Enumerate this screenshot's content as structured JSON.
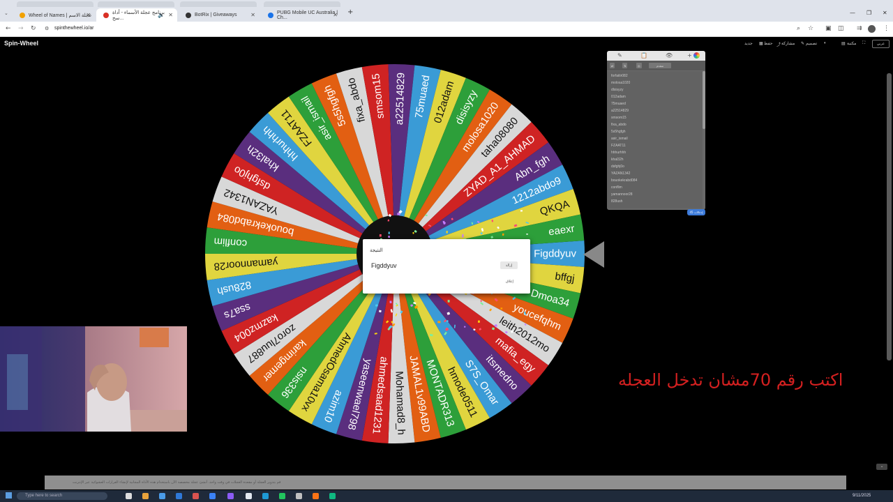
{
  "browser": {
    "tabs": [
      {
        "label": "Wheel of Names | عجلة الاسم",
        "color": "#f2a100"
      },
      {
        "label": "برنامج عجلة الأسماء - أداة سح...",
        "color": "#d93025"
      },
      {
        "label": "BotRix | Giveaways",
        "color": "#333333"
      },
      {
        "label": "PUBG Mobile UC Australia | Ch...",
        "color": "#1a73e8"
      }
    ],
    "url": "spinthewheel.io/ar"
  },
  "site": {
    "brand": "Spin-Wheel",
    "nav": {
      "new": "جديد",
      "save": "حفظ",
      "share": "مشاركة",
      "design": "تصميم",
      "library": "مكتبة",
      "language": "عربي"
    }
  },
  "wheel": {
    "entries": [
      "Figddyuv",
      "bffgj",
      "Dmoa34",
      "youcefqhm",
      "leith2012mo",
      "mafia_egy",
      "itsmedno",
      "S7S_Omar",
      "hmode0511",
      "MONTADR313",
      "JAMAL1v99ABD",
      "Mohamad8_h",
      "ahmedsaad1231",
      "yaseenwael798",
      "azim10",
      "AhmedOsama10vx",
      "nsis336",
      "karimgemer",
      "zoro7luu887",
      "kazmz004",
      "ssa7s",
      "828ush",
      "yamannoor28",
      "conflim",
      "bouokekrabd084",
      "YAZAN1342",
      "dsfghj0o",
      "khal32h",
      "hhhurhhh",
      "FZAAT11",
      "asir_ismail",
      "5s5hgfgh",
      "fixa_abdo",
      "smsom15",
      "a22514829",
      "75muaed",
      "012adam",
      "disisyzy",
      "molosa1020",
      "taha08080",
      "ZYAD_A1_AHMAD",
      "Abn_fgh",
      "1212abdo9",
      "QKQA",
      "eaexr"
    ],
    "colors": [
      "#3a9bd6",
      "#e0d53f",
      "#2d9f3a",
      "#e25f12",
      "#d8d8d8",
      "#cf2323",
      "#5a2e7e"
    ]
  },
  "result_dialog": {
    "title": "النتيجة",
    "winner": "Figddyuv",
    "remove_label": "إزالة",
    "close_label": "إغلاق"
  },
  "entries_panel": {
    "tab_entries": "✎",
    "tab_results": "📋",
    "tab_hide": "👁",
    "tab_add": "+",
    "shuffle": "⇄",
    "sort": "⇅",
    "image": "◎",
    "advanced": "متقدم",
    "count": "45 إدخالات",
    "entries_visible": [
      "forfaitir082",
      "molosa1020",
      "dlsisyzy",
      "012adam",
      "75muaed",
      "a22514829",
      "smsom15",
      "fixa_abdo",
      "5s5hgfgh",
      "asir_ismail",
      "FZAAT11",
      "hhhurhhh",
      "khal32h",
      "dsfghj0o",
      "YAZAN1342",
      "bouokekrabd084",
      "conflim",
      "yamannoor28",
      "828ush"
    ]
  },
  "overlay_text": "اكتب رقم 70مشان تدخل العجله",
  "bottom_banner": "قم بتدوير العجلة أو مقعدة العجلات في وقت واحد. أنشئ عجلة مخصصة الآن باستخدام هذه الأداة المجانية لإنشاء القرارات العشوائية عبر الإنترنت",
  "taskbar": {
    "search_placeholder": "Type here to search",
    "date": "9/11/2025"
  }
}
